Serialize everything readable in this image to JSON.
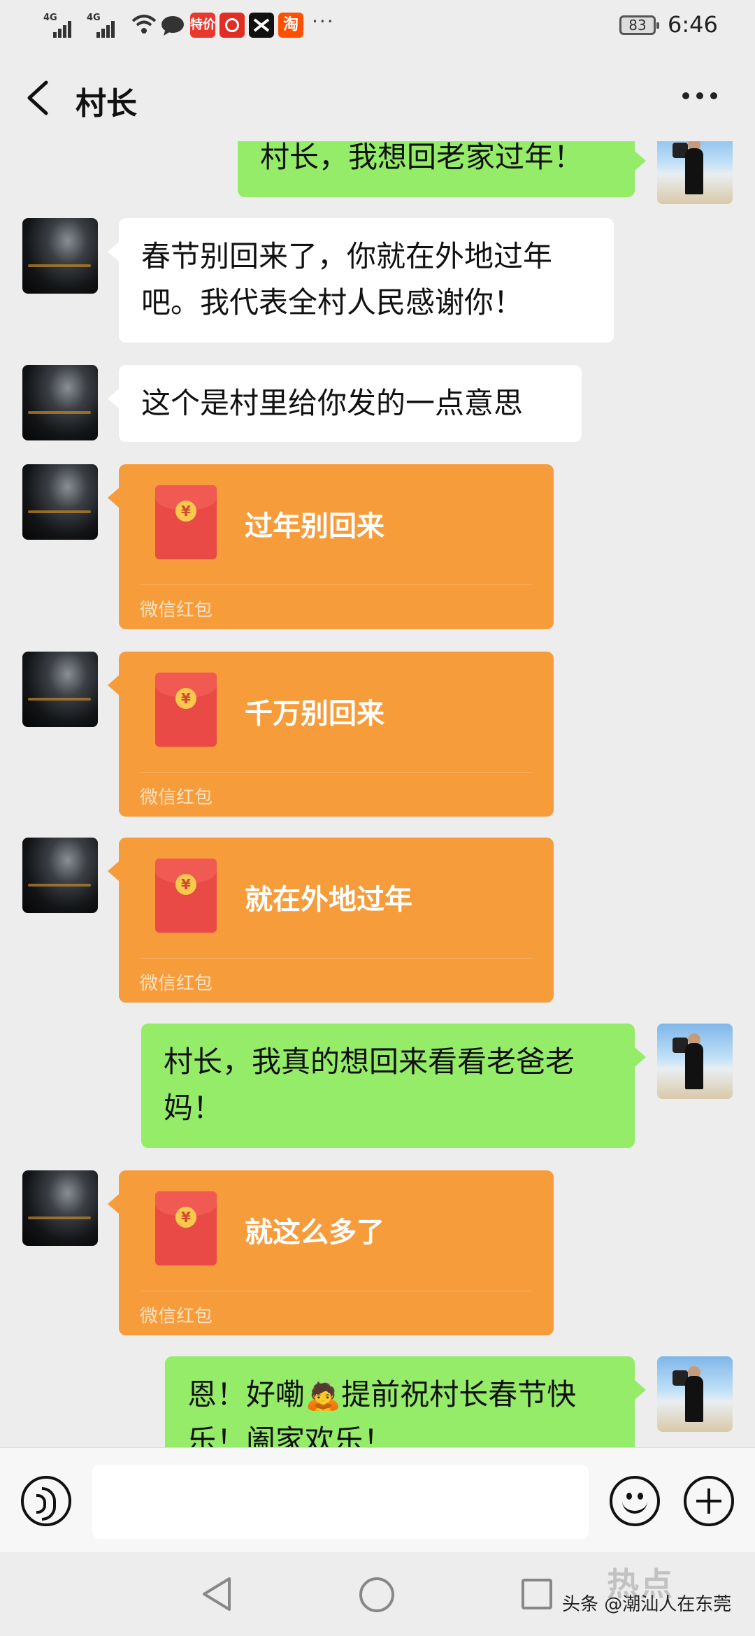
{
  "status_bar": {
    "signal1_label": "4G",
    "signal2_label": "4G",
    "icons": [
      "signal-icon",
      "signal-icon",
      "wifi-icon",
      "message-icon",
      "app-icon-tejia",
      "app-icon-pinduoduo",
      "app-icon-capcut",
      "app-icon-taobao"
    ],
    "app1_label": "特价",
    "app4_label": "淘",
    "more_dots": "···",
    "battery": "83",
    "time": "6:46"
  },
  "header": {
    "title": "村长"
  },
  "messages": [
    {
      "side": "right",
      "type": "text",
      "text": "村长，我想回老家过年！"
    },
    {
      "side": "left",
      "type": "text",
      "lines": [
        "春节别回来了，你就在外地过年",
        "吧。我代表全村人民感谢你！"
      ]
    },
    {
      "side": "left",
      "type": "text",
      "text": "这个是村里给你发的一点意思"
    },
    {
      "side": "left",
      "type": "red_packet",
      "title": "过年别回来",
      "footer": "微信红包"
    },
    {
      "side": "left",
      "type": "red_packet",
      "title": "千万别回来",
      "footer": "微信红包"
    },
    {
      "side": "left",
      "type": "red_packet",
      "title": "就在外地过年",
      "footer": "微信红包"
    },
    {
      "side": "right",
      "type": "text",
      "lines": [
        "村长，我真的想回来看看老爸老",
        "妈！"
      ]
    },
    {
      "side": "left",
      "type": "red_packet",
      "title": "就这么多了",
      "footer": "微信红包"
    },
    {
      "side": "right",
      "type": "text",
      "lines": [
        "恩！好嘞🙇提前祝村长春节快",
        "乐！阖家欢乐！"
      ]
    }
  ],
  "red_packet_symbol": "¥",
  "input_bar": {
    "icons": [
      "voice-icon",
      "emoji-icon",
      "plus-icon"
    ]
  },
  "nav_bar": {
    "icons": [
      "nav-back-icon",
      "nav-home-icon",
      "nav-recent-icon"
    ],
    "watermark": "头条 @潮汕人在东莞",
    "watermark_logo": "热点"
  },
  "colors": {
    "background": "#ededed",
    "my_bubble": "#95ec69",
    "their_bubble": "#ffffff",
    "red_packet": "#f79c3b",
    "envelope": "#e94a46"
  }
}
